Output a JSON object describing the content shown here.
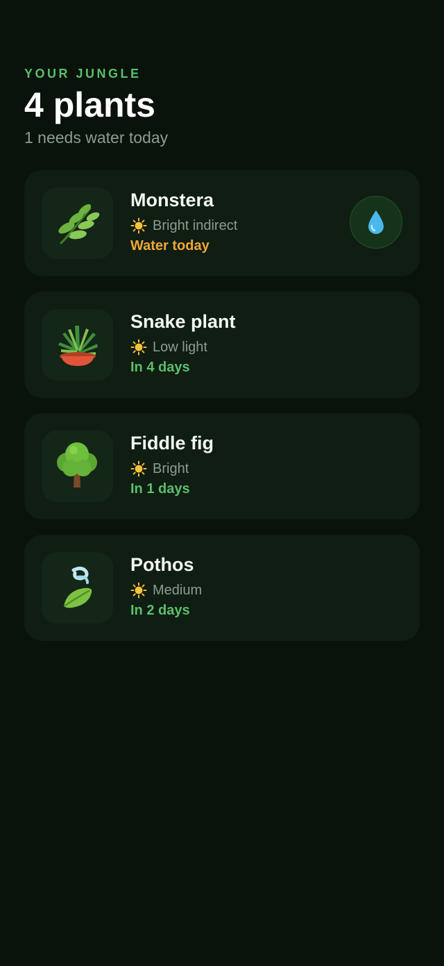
{
  "header": {
    "eyebrow": "YOUR JUNGLE",
    "title": "4 plants",
    "subtitle": "1 needs water today"
  },
  "colors": {
    "background": "#09120b",
    "card": "#0f1d12",
    "accent_green": "#5bbf6a",
    "due_orange": "#f0a736",
    "muted": "#8c9d8e"
  },
  "plants": [
    {
      "name": "Monstera",
      "icon": "herb-icon",
      "light": "Bright indirect",
      "status": "Water today",
      "status_color": "#f0a736",
      "action_icon": "water-drop-icon"
    },
    {
      "name": "Snake plant",
      "icon": "potted-plant-icon",
      "light": "Low light",
      "status": "In 4 days",
      "status_color": "#5bbf6a"
    },
    {
      "name": "Fiddle fig",
      "icon": "tree-icon",
      "light": "Bright",
      "status": "In 1 days",
      "status_color": "#5bbf6a"
    },
    {
      "name": "Pothos",
      "icon": "leaf-fluttering-icon",
      "light": "Medium",
      "status": "In 2 days",
      "status_color": "#5bbf6a"
    }
  ]
}
